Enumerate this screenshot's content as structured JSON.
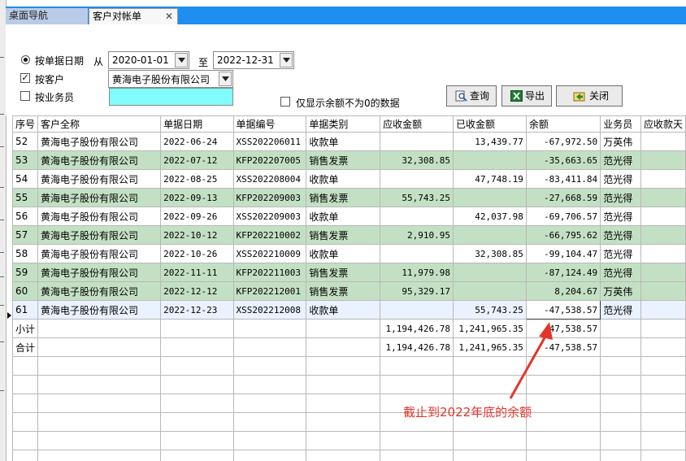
{
  "tabs": [
    {
      "label": "桌面导航"
    },
    {
      "label": "客户对帐单",
      "close": "✕"
    }
  ],
  "filters": {
    "by_date_label": "按单据日期",
    "from_label": "从",
    "date_from": "2020-01-01",
    "to_label": "至",
    "date_to": "2022-12-31",
    "by_customer_label": "按客户",
    "customer_value": "黄海电子股份有限公司",
    "by_salesperson_label": "按业务员",
    "salesperson_value": "",
    "nonzero_label": "仅显示余额不为0的数据"
  },
  "buttons": {
    "query": "查询",
    "export": "导出",
    "close": "关闭"
  },
  "table": {
    "columns": [
      "序号",
      "客户全称",
      "单据日期",
      "单据编号",
      "单据类别",
      "应收金额",
      "已收金额",
      "余额",
      "业务员",
      "应收款天"
    ],
    "rows": [
      {
        "no": "52",
        "customer": "黄海电子股份有限公司",
        "date": "2022-06-24",
        "doc": "XSS202206011",
        "type": "收款单",
        "recv": "",
        "paid": "13,439.77",
        "bal": "-67,972.50",
        "sales": "万英伟",
        "days": ""
      },
      {
        "no": "53",
        "customer": "黄海电子股份有限公司",
        "date": "2022-07-12",
        "doc": "KFP202207005",
        "type": "销售发票",
        "recv": "32,308.85",
        "paid": "",
        "bal": "-35,663.65",
        "sales": "范光得",
        "days": ""
      },
      {
        "no": "54",
        "customer": "黄海电子股份有限公司",
        "date": "2022-08-25",
        "doc": "XSS202208004",
        "type": "收款单",
        "recv": "",
        "paid": "47,748.19",
        "bal": "-83,411.84",
        "sales": "范光得",
        "days": ""
      },
      {
        "no": "55",
        "customer": "黄海电子股份有限公司",
        "date": "2022-09-13",
        "doc": "KFP202209003",
        "type": "销售发票",
        "recv": "55,743.25",
        "paid": "",
        "bal": "-27,668.59",
        "sales": "范光得",
        "days": ""
      },
      {
        "no": "56",
        "customer": "黄海电子股份有限公司",
        "date": "2022-09-26",
        "doc": "XSS202209003",
        "type": "收款单",
        "recv": "",
        "paid": "42,037.98",
        "bal": "-69,706.57",
        "sales": "范光得",
        "days": ""
      },
      {
        "no": "57",
        "customer": "黄海电子股份有限公司",
        "date": "2022-10-12",
        "doc": "KFP202210002",
        "type": "销售发票",
        "recv": "2,910.95",
        "paid": "",
        "bal": "-66,795.62",
        "sales": "范光得",
        "days": ""
      },
      {
        "no": "58",
        "customer": "黄海电子股份有限公司",
        "date": "2022-10-26",
        "doc": "XSS202210009",
        "type": "收款单",
        "recv": "",
        "paid": "32,308.85",
        "bal": "-99,104.47",
        "sales": "范光得",
        "days": ""
      },
      {
        "no": "59",
        "customer": "黄海电子股份有限公司",
        "date": "2022-11-11",
        "doc": "KFP202211003",
        "type": "销售发票",
        "recv": "11,979.98",
        "paid": "",
        "bal": "-87,124.49",
        "sales": "范光得",
        "days": ""
      },
      {
        "no": "60",
        "customer": "黄海电子股份有限公司",
        "date": "2022-12-12",
        "doc": "KFP202212001",
        "type": "销售发票",
        "recv": "95,329.17",
        "paid": "",
        "bal": "8,204.67",
        "sales": "万英伟",
        "days": ""
      },
      {
        "no": "61",
        "customer": "黄海电子股份有限公司",
        "date": "2022-12-23",
        "doc": "XSS202212008",
        "type": "收款单",
        "recv": "",
        "paid": "55,743.25",
        "bal": "-47,538.57",
        "sales": "范光得",
        "days": ""
      }
    ],
    "subtotal": {
      "label": "小计",
      "recv": "1,194,426.78",
      "paid": "1,241,965.35",
      "bal": "-47,538.57"
    },
    "total": {
      "label": "合计",
      "recv": "1,194,426.78",
      "paid": "1,241,965.35",
      "bal": "-47,538.57"
    }
  },
  "annotation": "截止到2022年底的余额",
  "colors": {
    "tabbar": "#1e8ef0",
    "green_row": "#c4e0c4",
    "annotation": "#e8332a",
    "cyan_field": "#80fcfc"
  }
}
